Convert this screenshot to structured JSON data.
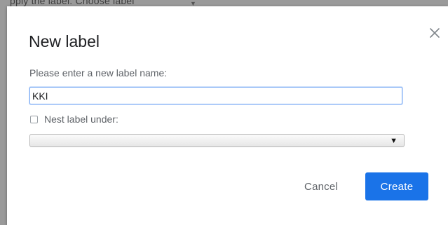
{
  "background": {
    "partial_text": "pply the label:  Choose label"
  },
  "dialog": {
    "title": "New label",
    "close_glyph": "×",
    "prompt": "Please enter a new label name:",
    "name_input_value": "KKI",
    "nest_label": "Nest label under:",
    "nest_checked": false,
    "nest_select_value": "",
    "select_arrow_glyph": "▼",
    "cancel_label": "Cancel",
    "create_label": "Create"
  },
  "colors": {
    "primary": "#1a73e8",
    "text_secondary": "#5f6368",
    "title_text": "#202124"
  },
  "icons": {
    "close": "close-icon",
    "select": "dropdown-arrow-icon"
  }
}
